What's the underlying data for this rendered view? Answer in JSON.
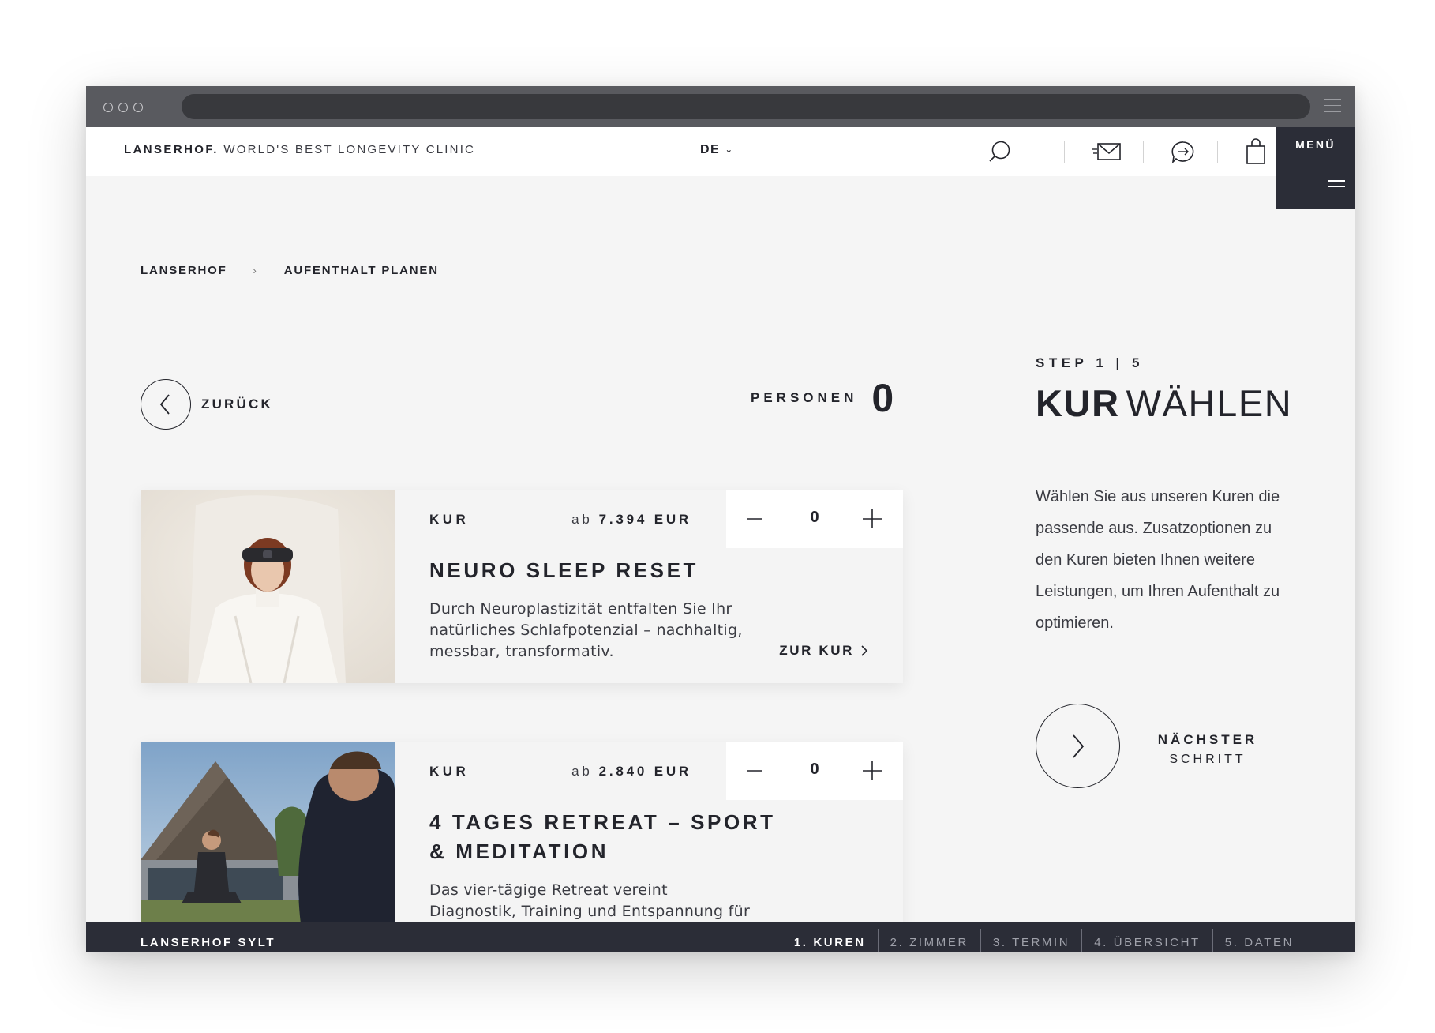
{
  "header": {
    "brand_name": "LANSERHOF.",
    "brand_tagline": "WORLD'S BEST LONGEVITY CLINIC",
    "language": "DE",
    "menu_label": "MENÜ",
    "icons": [
      "search-icon",
      "mail-icon",
      "chat-icon",
      "shopping-bag-icon",
      "hamburger-icon"
    ]
  },
  "breadcrumb": {
    "items": [
      "LANSERHOF",
      "AUFENTHALT PLANEN"
    ]
  },
  "booking": {
    "back_label": "ZURÜCK",
    "persons_label": "PERSONEN",
    "persons_count": "0"
  },
  "cards": [
    {
      "type_label": "KUR",
      "price_prefix": "ab",
      "price": "7.394 EUR",
      "quantity": "0",
      "title": "NEURO SLEEP RESET",
      "description": "Durch Neuroplastizität entfalten Sie Ihr natürliches Schlafpotenzial – nachhaltig, messbar, transformativ.",
      "link_label": "ZUR KUR"
    },
    {
      "type_label": "KUR",
      "price_prefix": "ab",
      "price": "2.840 EUR",
      "quantity": "0",
      "title": "4 TAGES RETREAT – SPORT & MEDITATION",
      "description": "Das vier-tägige Retreat vereint Diagnostik, Training und Entspannung für ganzheitliches"
    }
  ],
  "sidebar": {
    "step": "STEP 1 | 5",
    "heading_bold": "KUR",
    "heading_light": "WÄHLEN",
    "intro": "Wählen Sie aus unseren Kuren die passende aus. Zusatzoptionen zu den Kuren bieten Ihnen weitere Leistungen, um Ihren Aufenthalt zu optimieren.",
    "next_line1": "NÄCHSTER",
    "next_line2": "SCHRITT"
  },
  "footer": {
    "location": "LANSERHOF SYLT",
    "steps": [
      "1. KUREN",
      "2. ZIMMER",
      "3. TERMIN",
      "4. ÜBERSICHT",
      "5. DATEN"
    ],
    "active_step": "1. KUREN"
  },
  "colors": {
    "dark_navy": "#2b2d37",
    "page_bg": "#f5f5f5",
    "text": "#23242b"
  }
}
